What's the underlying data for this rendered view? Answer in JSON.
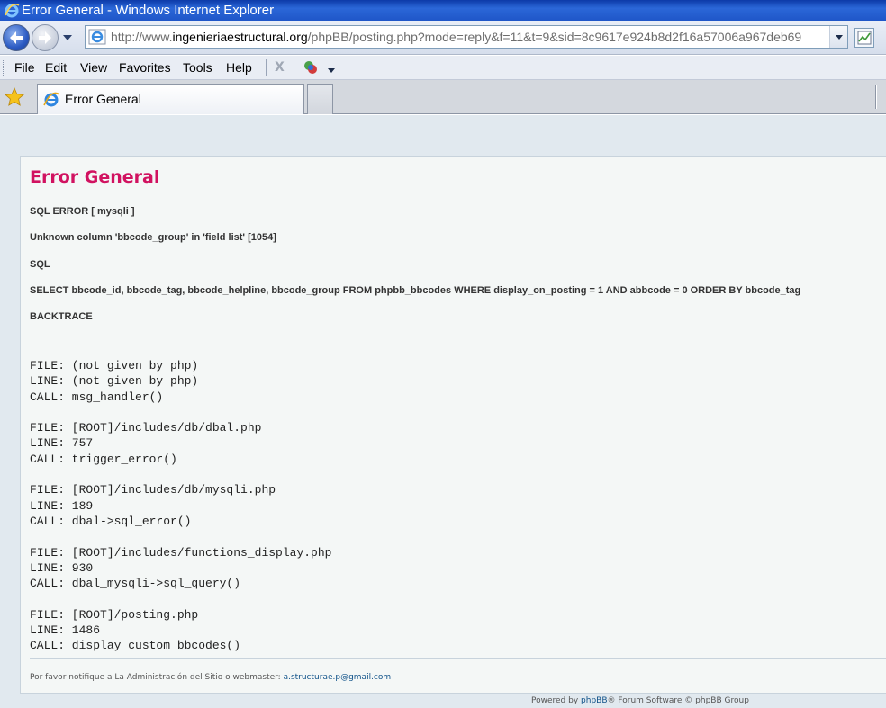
{
  "window": {
    "title": "Error General - Windows Internet Explorer"
  },
  "address_bar": {
    "url_prefix": "http://www.",
    "url_domain": "ingenieriaestructural.org",
    "url_path": "/phpBB/posting.php?mode=reply&f=11&t=9&sid=8c9617e924b8d2f16a57006a967deb69"
  },
  "menu": {
    "items": [
      "File",
      "Edit",
      "View",
      "Favorites",
      "Tools",
      "Help"
    ],
    "stop_glyph": "X"
  },
  "tabs": [
    {
      "label": "Error General"
    }
  ],
  "page": {
    "heading": "Error General",
    "sql_error": "SQL ERROR [ mysqli ]",
    "message": "Unknown column 'bbcode_group' in 'field list' [1054]",
    "sql_label": "SQL",
    "query": "SELECT bbcode_id, bbcode_tag, bbcode_helpline, bbcode_group FROM phpbb_bbcodes WHERE display_on_posting = 1 AND abbcode = 0 ORDER BY bbcode_tag",
    "backtrace_label": "BACKTRACE",
    "backtrace": [
      {
        "file": "FILE: (not given by php)",
        "line": "LINE: (not given by php)",
        "call": "CALL: msg_handler()"
      },
      {
        "file": "FILE: [ROOT]/includes/db/dbal.php",
        "line": "LINE: 757",
        "call": "CALL: trigger_error()"
      },
      {
        "file": "FILE: [ROOT]/includes/db/mysqli.php",
        "line": "LINE: 189",
        "call": "CALL: dbal->sql_error()"
      },
      {
        "file": "FILE: [ROOT]/includes/functions_display.php",
        "line": "LINE: 930",
        "call": "CALL: dbal_mysqli->sql_query()"
      },
      {
        "file": "FILE: [ROOT]/posting.php",
        "line": "LINE: 1486",
        "call": "CALL: display_custom_bbcodes()"
      }
    ],
    "notice_text": "Por favor notifique a La Administración del Sitio o webmaster: ",
    "notice_email": "a.structurae.p@gmail.com",
    "footer_prefix": "Powered by ",
    "footer_link": "phpBB",
    "footer_suffix": "® Forum Software © phpBB Group"
  },
  "colors": {
    "title_bar": "#1f56c8",
    "error_heading": "#d11260",
    "link": "#105289",
    "page_bg": "#e1e9ef",
    "panel_bg": "#f4f7f6"
  }
}
